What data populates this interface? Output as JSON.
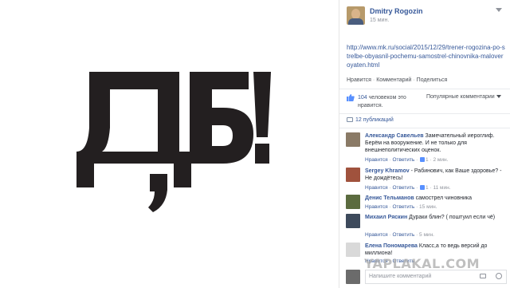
{
  "photo": {
    "glyphs": "ДБ!"
  },
  "post": {
    "author": "Dmitry Rogozin",
    "time": "15 мин.",
    "link_text": "http://www.mk.ru/social/2015/12/29/trener-rogozina-po-strelbe-obyasnil-pochemu-samostrel-chinovnika-maloveroyaten.html"
  },
  "actions": {
    "like": "Нравится",
    "comment": "Комментарий",
    "share": "Поделиться"
  },
  "likes": {
    "count": "104",
    "text": "человеком это нравится."
  },
  "sort_label": "Популярные комментарии",
  "shares": "12 публикаций",
  "comments": [
    {
      "name": "Александр Савельев",
      "text": "Замечательный иероглиф. Берём на вооружение. И не только для внешнеполитических оценок.",
      "like": "Нравится",
      "reply": "Ответить",
      "likes": "1",
      "time": "2 мин."
    },
    {
      "name": "Sergey Khramov",
      "text": "- Рабинович, как Ваше здоровье? - Не дождётесь!",
      "like": "Нравится",
      "reply": "Ответить",
      "likes": "1",
      "time": "11 мин."
    },
    {
      "name": "Денис Тельманов",
      "text": "самострел чиновника",
      "like": "Нравится",
      "reply": "Ответить",
      "likes": "",
      "time": "15 мин."
    },
    {
      "name": "Михаил Ряскин",
      "text": "Дураки блин? ( поштуил если чё)",
      "like": "Нравится",
      "reply": "Ответить",
      "likes": "",
      "time": "5 мин."
    },
    {
      "name": "Елена Пономарева",
      "text": "Класс,а то ведь версий до миллиона!",
      "like": "Нравится",
      "reply": "Ответить",
      "likes": "",
      "time": ""
    }
  ],
  "write_placeholder": "Напишите комментарий",
  "watermark": "YAPLAKAL.COM",
  "colors": {
    "link": "#365899",
    "muted": "#90949c",
    "glyph": "#231f20"
  }
}
